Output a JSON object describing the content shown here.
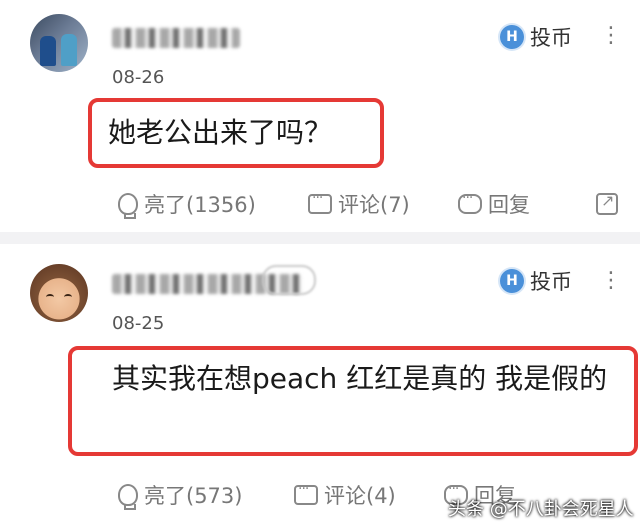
{
  "comments": [
    {
      "username": "",
      "date": "08-26",
      "coin_label": "投币",
      "coin_icon": "H",
      "more_icon": "⋮",
      "content": "她老公出来了吗？",
      "actions": {
        "like_label": "亮了(1356)",
        "comment_label": "评论(7)",
        "reply_label": "回复"
      }
    },
    {
      "username": "",
      "date": "08-25",
      "coin_label": "投币",
      "coin_icon": "H",
      "more_icon": "⋮",
      "content": "其实我在想peach 红红是真的 我是假的",
      "actions": {
        "like_label": "亮了(573)",
        "comment_label": "评论(4)",
        "reply_label": "回复"
      }
    }
  ],
  "watermark": "头条 @不八卦会死星人",
  "colors": {
    "highlight_border": "#e53935",
    "coin_icon_bg": "#4a90d9",
    "secondary_text": "#777777"
  }
}
